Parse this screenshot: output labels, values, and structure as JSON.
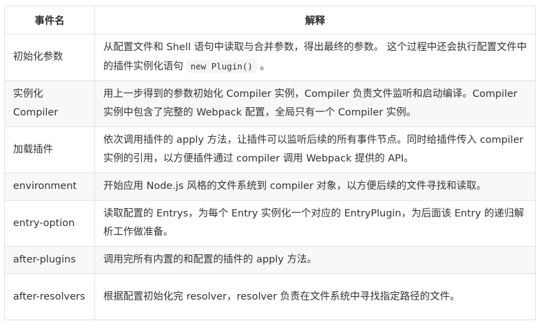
{
  "table": {
    "headers": {
      "name": "事件名",
      "desc": "解释"
    },
    "rows": [
      {
        "name": "初始化参数",
        "desc_before": "从配置文件和 Shell 语句中读取与合并参数，得出最终的参数。 这个过程中还会执行配置文件中的插件实例化语句 ",
        "code": "new Plugin()",
        "desc_after": " 。"
      },
      {
        "name": "实例化 Compiler",
        "desc": "用上一步得到的参数初始化 Compiler 实例，Compiler 负责文件监听和启动编译。Compiler 实例中包含了完整的 Webpack 配置，全局只有一个 Compiler 实例。"
      },
      {
        "name": "加载插件",
        "desc": "依次调用插件的 apply 方法，让插件可以监听后续的所有事件节点。同时给插件传入 compiler 实例的引用，以方便插件通过 compiler 调用 Webpack 提供的 API。"
      },
      {
        "name": "environment",
        "desc": "开始应用 Node.js 风格的文件系统到 compiler 对象，以方便后续的文件寻找和读取。"
      },
      {
        "name": "entry-option",
        "desc": "读取配置的 Entrys，为每个 Entry 实例化一个对应的 EntryPlugin，为后面该 Entry 的递归解析工作做准备。"
      },
      {
        "name": "after-plugins",
        "desc": "调用完所有内置的和配置的插件的 apply 方法。"
      },
      {
        "name": "after-resolvers",
        "desc": "根据配置初始化完 resolver，resolver 负责在文件系统中寻找指定路径的文件。"
      }
    ]
  }
}
